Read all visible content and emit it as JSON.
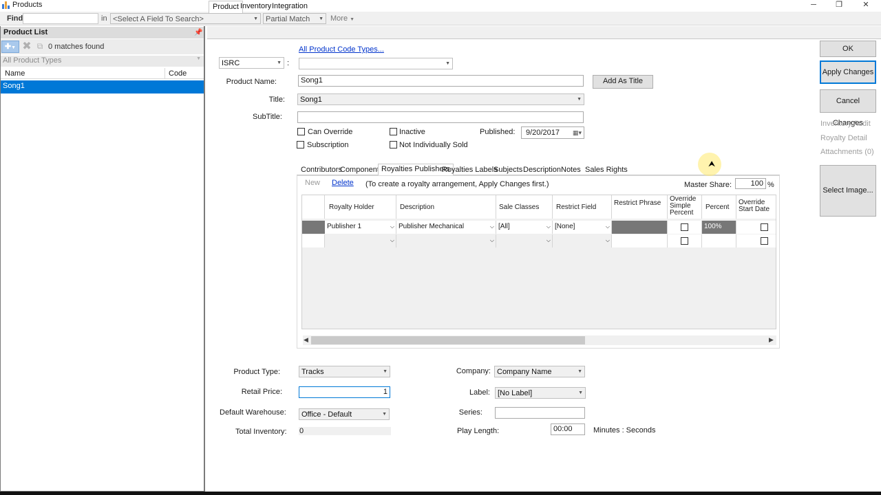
{
  "window": {
    "title": "Products",
    "controls": [
      "─",
      "❐",
      "✕"
    ]
  },
  "toolbar": {
    "find_label": "Find",
    "find_value": "",
    "in_label": "in",
    "field_placeholder": "<Select A Field To Search>",
    "match_mode": "Partial Match",
    "more_label": "More"
  },
  "product_list": {
    "header": "Product List",
    "matches": "0 matches found",
    "filter": "All Product Types",
    "columns": [
      "Name",
      "Code"
    ],
    "rows": [
      {
        "name": "Song1",
        "code": ""
      }
    ]
  },
  "main_tabs": [
    "Product",
    "Inventory",
    "Integration"
  ],
  "product": {
    "code_types_link": "All Product Code Types...",
    "code_type": "ISRC",
    "code_value": "",
    "product_name_label": "Product Name:",
    "product_name": "Song1",
    "add_as_title": "Add As Title",
    "title_label": "Title:",
    "title": "Song1",
    "subtitle_label": "SubTitle:",
    "subtitle": "",
    "can_override": "Can Override",
    "inactive": "Inactive",
    "subscription": "Subscription",
    "not_individually_sold": "Not Individually Sold",
    "published_label": "Published:",
    "published": "9/20/2017"
  },
  "inner_tabs": [
    "Contributors",
    "Components",
    "Royalties Publishers",
    "Royalties Labels",
    "Subjects",
    "Description",
    "Notes",
    "Sales Rights"
  ],
  "royalties": {
    "new_label": "New",
    "delete_label": "Delete",
    "hint": "(To create a royalty arrangement, Apply Changes first.)",
    "master_share_label": "Master Share:",
    "master_share": "100",
    "percent_sign": "%",
    "columns": [
      "Royalty Holder",
      "Description",
      "Sale Classes",
      "Restrict Field",
      "Restrict Phrase",
      "Override Simple Percent",
      "Percent",
      "Override Start Date"
    ],
    "rows": [
      {
        "holder": "Publisher 1",
        "description": "Publisher Mechanical",
        "sale_classes": "[All]",
        "restrict_field": "[None]",
        "restrict_phrase": "",
        "percent": "100%"
      }
    ]
  },
  "details": {
    "product_type_label": "Product Type:",
    "product_type": "Tracks",
    "retail_price_label": "Retail Price:",
    "retail_price": "1",
    "default_warehouse_label": "Default Warehouse:",
    "default_warehouse": "Office - Default",
    "total_inventory_label": "Total Inventory:",
    "total_inventory": "0",
    "company_label": "Company:",
    "company": "Company Name",
    "label_label": "Label:",
    "label": "[No Label]",
    "series_label": "Series:",
    "series": "",
    "play_length_label": "Play Length:",
    "play_length": "00:00",
    "play_length_unit": "Minutes : Seconds"
  },
  "actions": {
    "ok": "OK",
    "apply": "Apply Changes",
    "cancel": "Cancel Changes",
    "inventory_audit": "Inventory Audit",
    "royalty_detail": "Royalty Detail",
    "attachments": "Attachments (0)",
    "select_image": "Select Image..."
  },
  "colors": {
    "selection": "#0078d7",
    "link": "#0033cc",
    "panel_bg": "#f0f0f0"
  }
}
